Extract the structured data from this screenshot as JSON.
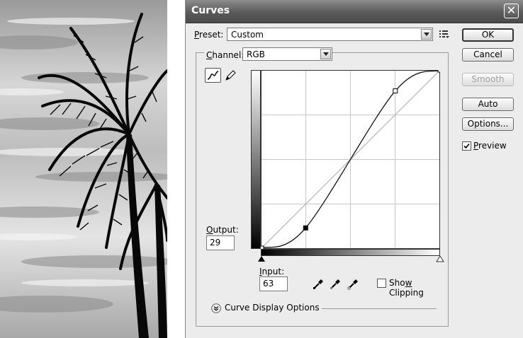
{
  "dialog": {
    "title": "Curves",
    "close_glyph": "✕"
  },
  "preset": {
    "label_prefix": "P",
    "label_rest": "reset:",
    "value": "Custom"
  },
  "channel": {
    "label_prefix": "C",
    "label_rest": "hannel:",
    "value": "RGB"
  },
  "curve": {
    "points": [
      [
        0,
        0
      ],
      [
        63,
        29
      ],
      [
        191,
        225
      ],
      [
        255,
        255
      ]
    ],
    "selected_point": [
      63,
      29
    ]
  },
  "output": {
    "label_prefix": "O",
    "label_rest": "utput:",
    "value": "29"
  },
  "input": {
    "label_prefix": "I",
    "label_rest": "nput:",
    "value": "63"
  },
  "show_clipping": {
    "label_pre": "Sho",
    "label_mnemonic": "w",
    "label_post": " Clipping",
    "checked": false
  },
  "curve_display_options": {
    "label": "Curve Display Options",
    "expanded": false
  },
  "buttons": {
    "ok": "OK",
    "cancel": "Cancel",
    "smooth": "Smooth",
    "auto": "Auto",
    "options": "Options..."
  },
  "preview": {
    "label_prefix": "P",
    "label_rest": "review",
    "checked": true
  },
  "icons": [
    "close-icon",
    "preset-menu-icon",
    "curve-tool-icon",
    "pencil-tool-icon",
    "black-eyedropper-icon",
    "gray-eyedropper-icon",
    "white-eyedropper-icon",
    "expand-chevron-icon"
  ]
}
